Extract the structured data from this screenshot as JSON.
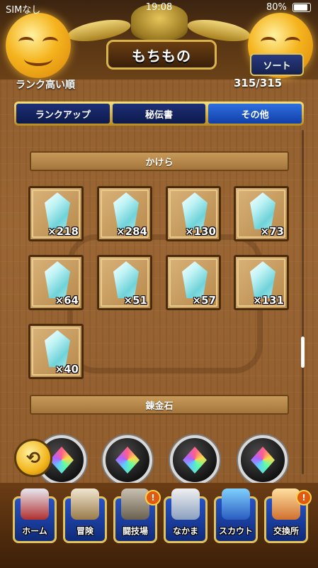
{
  "status_bar": {
    "carrier": "SIMなし",
    "time": "19:08",
    "battery": "80%"
  },
  "header": {
    "title": "もちもの",
    "sort_button": "ソート",
    "sort_mode": "ランク高い順",
    "count": "315/315"
  },
  "tabs": [
    {
      "label": "ランクアップ",
      "active": false
    },
    {
      "label": "秘伝書",
      "active": false
    },
    {
      "label": "その他",
      "active": true
    }
  ],
  "sections": [
    {
      "title": "かけら"
    },
    {
      "title": "錬金石"
    }
  ],
  "fragments": [
    {
      "qty": "×218"
    },
    {
      "qty": "×284"
    },
    {
      "qty": "×130"
    },
    {
      "qty": "×73"
    },
    {
      "qty": "×64"
    },
    {
      "qty": "×51"
    },
    {
      "qty": "×57"
    },
    {
      "qty": "×131"
    },
    {
      "qty": "×40"
    }
  ],
  "nav": [
    {
      "label": "ホーム",
      "badge": ""
    },
    {
      "label": "冒険",
      "badge": ""
    },
    {
      "label": "闘技場",
      "badge": "!"
    },
    {
      "label": "なかま",
      "badge": ""
    },
    {
      "label": "スカウト",
      "badge": ""
    },
    {
      "label": "交換所",
      "badge": "!"
    }
  ]
}
